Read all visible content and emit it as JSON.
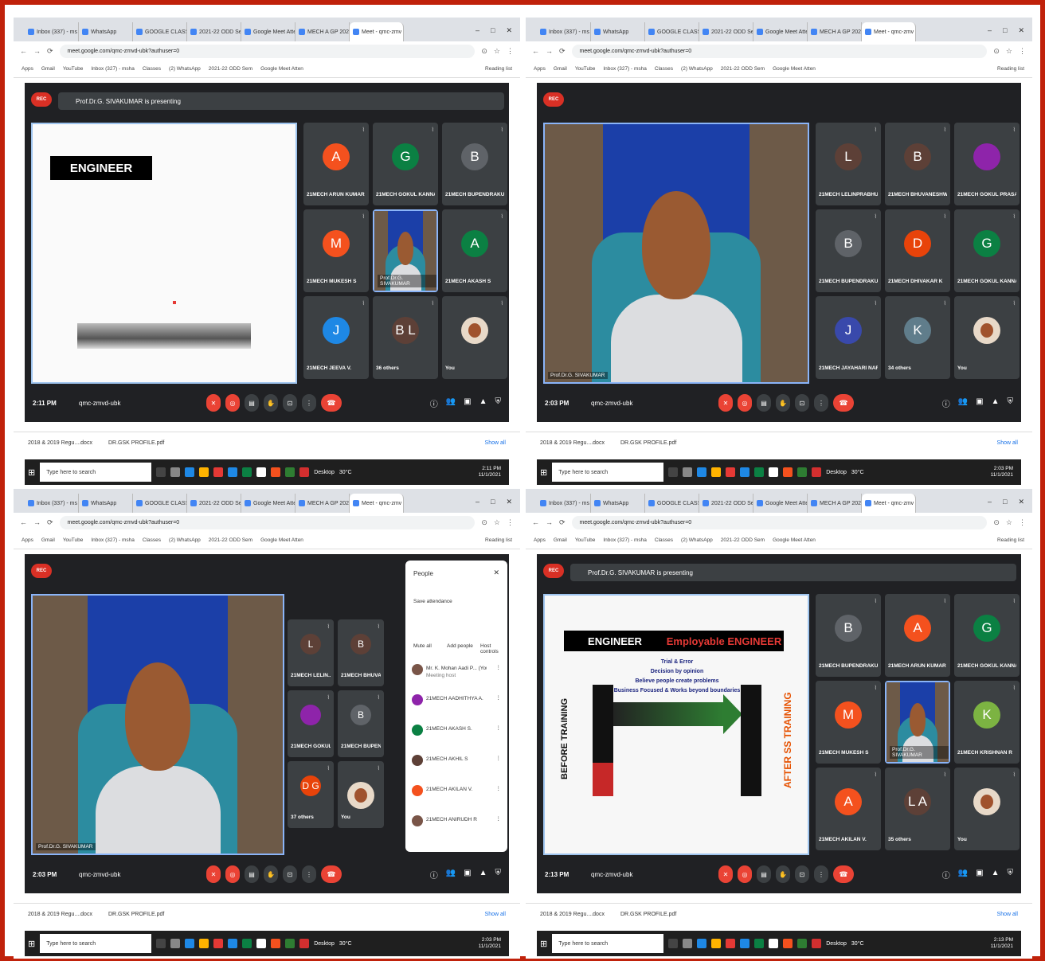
{
  "tabs": [
    "Inbox (337) - ms",
    "WhatsApp",
    "GOOGLE CLASS",
    "2021-22 ODD Se",
    "Google Meet Atte",
    "MECH A GP 2021",
    "Meet - qmc-zmv"
  ],
  "bookmarks": [
    "Apps",
    "Gmail",
    "YouTube",
    "Inbox (327) - msha",
    "Classes",
    "(2) WhatsApp",
    "2021-22 ODD Sem",
    "Google Meet Atten",
    "Reading list"
  ],
  "url": "meet.google.com/qmc-zmvd-ubk?authuser=0",
  "presenting": "Prof.Dr.G. SIVAKUMAR is presenting",
  "rec": "REC",
  "meeting_code": "qmc-zmvd-ubk",
  "host_name": "Prof.Dr.G. SIVAKUMAR",
  "downloads": {
    "file1": "2018 & 2019 Regu....docx",
    "file2": "DR.GSK PROFILE.pdf",
    "show_all": "Show all"
  },
  "taskbar": {
    "search": "Type here to search",
    "weather": "30°C",
    "date": "11/1/2021",
    "desktop": "Desktop"
  },
  "quads": [
    {
      "clock": "2:11 PM",
      "tiles": [
        {
          "type": "avatar",
          "letter": "A",
          "color": "#f4511e",
          "name": "21MECH ARUN KUMAR S"
        },
        {
          "type": "avatar",
          "letter": "G",
          "color": "#0b8043",
          "name": "21MECH GOKUL KANNA..."
        },
        {
          "type": "avatar",
          "letter": "B",
          "color": "#5f6368",
          "name": "21MECH BUPENDRAKUM..."
        },
        {
          "type": "avatar",
          "letter": "M",
          "color": "#f4511e",
          "name": "21MECH MUKESH S"
        },
        {
          "type": "video",
          "letter": "",
          "color": "",
          "name": "Prof.Dr.G. SIVAKUMAR"
        },
        {
          "type": "avatar",
          "letter": "A",
          "color": "#0b8043",
          "name": "21MECH AKASH S"
        },
        {
          "type": "avatar",
          "letter": "J",
          "color": "#1e88e5",
          "name": "21MECH JEEVA V."
        },
        {
          "type": "others",
          "letter": "B L",
          "color": "#5d4037",
          "name": "36 others"
        },
        {
          "type": "self",
          "letter": "",
          "color": "",
          "name": "You"
        }
      ],
      "slide_title": "ENGINEER"
    },
    {
      "clock": "2:03 PM",
      "tiles": [
        {
          "type": "avatar",
          "letter": "L",
          "color": "#5d4037",
          "name": "21MECH LELINPRABHU M."
        },
        {
          "type": "avatar",
          "letter": "B",
          "color": "#5d4037",
          "name": "21MECH BHUVANESHWA..."
        },
        {
          "type": "avatar",
          "letter": "",
          "color": "#8e24aa",
          "name": "21MECH GOKUL PRASAN..."
        },
        {
          "type": "avatar",
          "letter": "B",
          "color": "#5f6368",
          "name": "21MECH BUPENDRAKUM..."
        },
        {
          "type": "avatar",
          "letter": "D",
          "color": "#e8430a",
          "name": "21MECH DHIVAKAR K"
        },
        {
          "type": "avatar",
          "letter": "G",
          "color": "#0b8043",
          "name": "21MECH GOKUL KANNA..."
        },
        {
          "type": "avatar",
          "letter": "J",
          "color": "#3949ab",
          "name": "21MECH JAYAHARI NARA..."
        },
        {
          "type": "others",
          "letter": "K",
          "color": "#607d8b",
          "name": "34 others"
        },
        {
          "type": "self",
          "letter": "",
          "color": "",
          "name": "You"
        }
      ],
      "present_now": "Present now"
    },
    {
      "clock": "2:03 PM",
      "tiles": [
        {
          "type": "avatar",
          "letter": "L",
          "color": "#5d4037",
          "name": "21MECH LELIN..."
        },
        {
          "type": "avatar",
          "letter": "B",
          "color": "#5d4037",
          "name": "21MECH BHUVA..."
        },
        {
          "type": "avatar",
          "letter": "",
          "color": "#8e24aa",
          "name": "21MECH GOKUL..."
        },
        {
          "type": "avatar",
          "letter": "B",
          "color": "#5f6368",
          "name": "21MECH BUPEN..."
        },
        {
          "type": "others",
          "letter": "D G",
          "color": "#e8430a",
          "name": "37 others"
        },
        {
          "type": "self",
          "letter": "",
          "color": "",
          "name": "You"
        }
      ],
      "people": {
        "title": "People",
        "attendance": "Save attendance",
        "actions": [
          "Mute all",
          "Add people",
          "Host controls"
        ],
        "list": [
          {
            "name": "Mr. K. Mohan Aadi P... (You)",
            "sub": "Meeting host",
            "color": "#795548"
          },
          {
            "name": "21MECH AADHITHYA A.",
            "sub": "",
            "color": "#8e24aa"
          },
          {
            "name": "21MECH AKASH S.",
            "sub": "",
            "color": "#0b8043"
          },
          {
            "name": "21MECH AKHIL S",
            "sub": "",
            "color": "#5d4037"
          },
          {
            "name": "21MECH AKILAN V.",
            "sub": "",
            "color": "#f4511e"
          },
          {
            "name": "21MECH ANIRUDH R",
            "sub": "",
            "color": "#795548"
          }
        ]
      }
    },
    {
      "clock": "2:13 PM",
      "tiles": [
        {
          "type": "avatar",
          "letter": "B",
          "color": "#5f6368",
          "name": "21MECH BUPENDRAKUM..."
        },
        {
          "type": "avatar",
          "letter": "A",
          "color": "#f4511e",
          "name": "21MECH ARUN KUMAR S."
        },
        {
          "type": "avatar",
          "letter": "G",
          "color": "#0b8043",
          "name": "21MECH GOKUL KANNA..."
        },
        {
          "type": "avatar",
          "letter": "M",
          "color": "#f4511e",
          "name": "21MECH MUKESH S"
        },
        {
          "type": "video",
          "letter": "",
          "color": "",
          "name": "Prof.Dr.G. SIVAKUMAR"
        },
        {
          "type": "avatar",
          "letter": "K",
          "color": "#7cb342",
          "name": "21MECH KRISHNAN R"
        },
        {
          "type": "avatar",
          "letter": "A",
          "color": "#f4511e",
          "name": "21MECH AKILAN V."
        },
        {
          "type": "others",
          "letter": "L A",
          "color": "#5d4037",
          "name": "35 others"
        },
        {
          "type": "self",
          "letter": "",
          "color": "",
          "name": "You"
        }
      ],
      "slide": {
        "left": "ENGINEER",
        "right": "Employable ENGINEER",
        "lines": [
          "Trial & Error",
          "Decision by opinion",
          "Believe people create problems",
          "Business Focused & Works beyond boundaries"
        ],
        "before": "BEFORE TRAINING",
        "after": "AFTER SS TRAINING"
      }
    }
  ]
}
